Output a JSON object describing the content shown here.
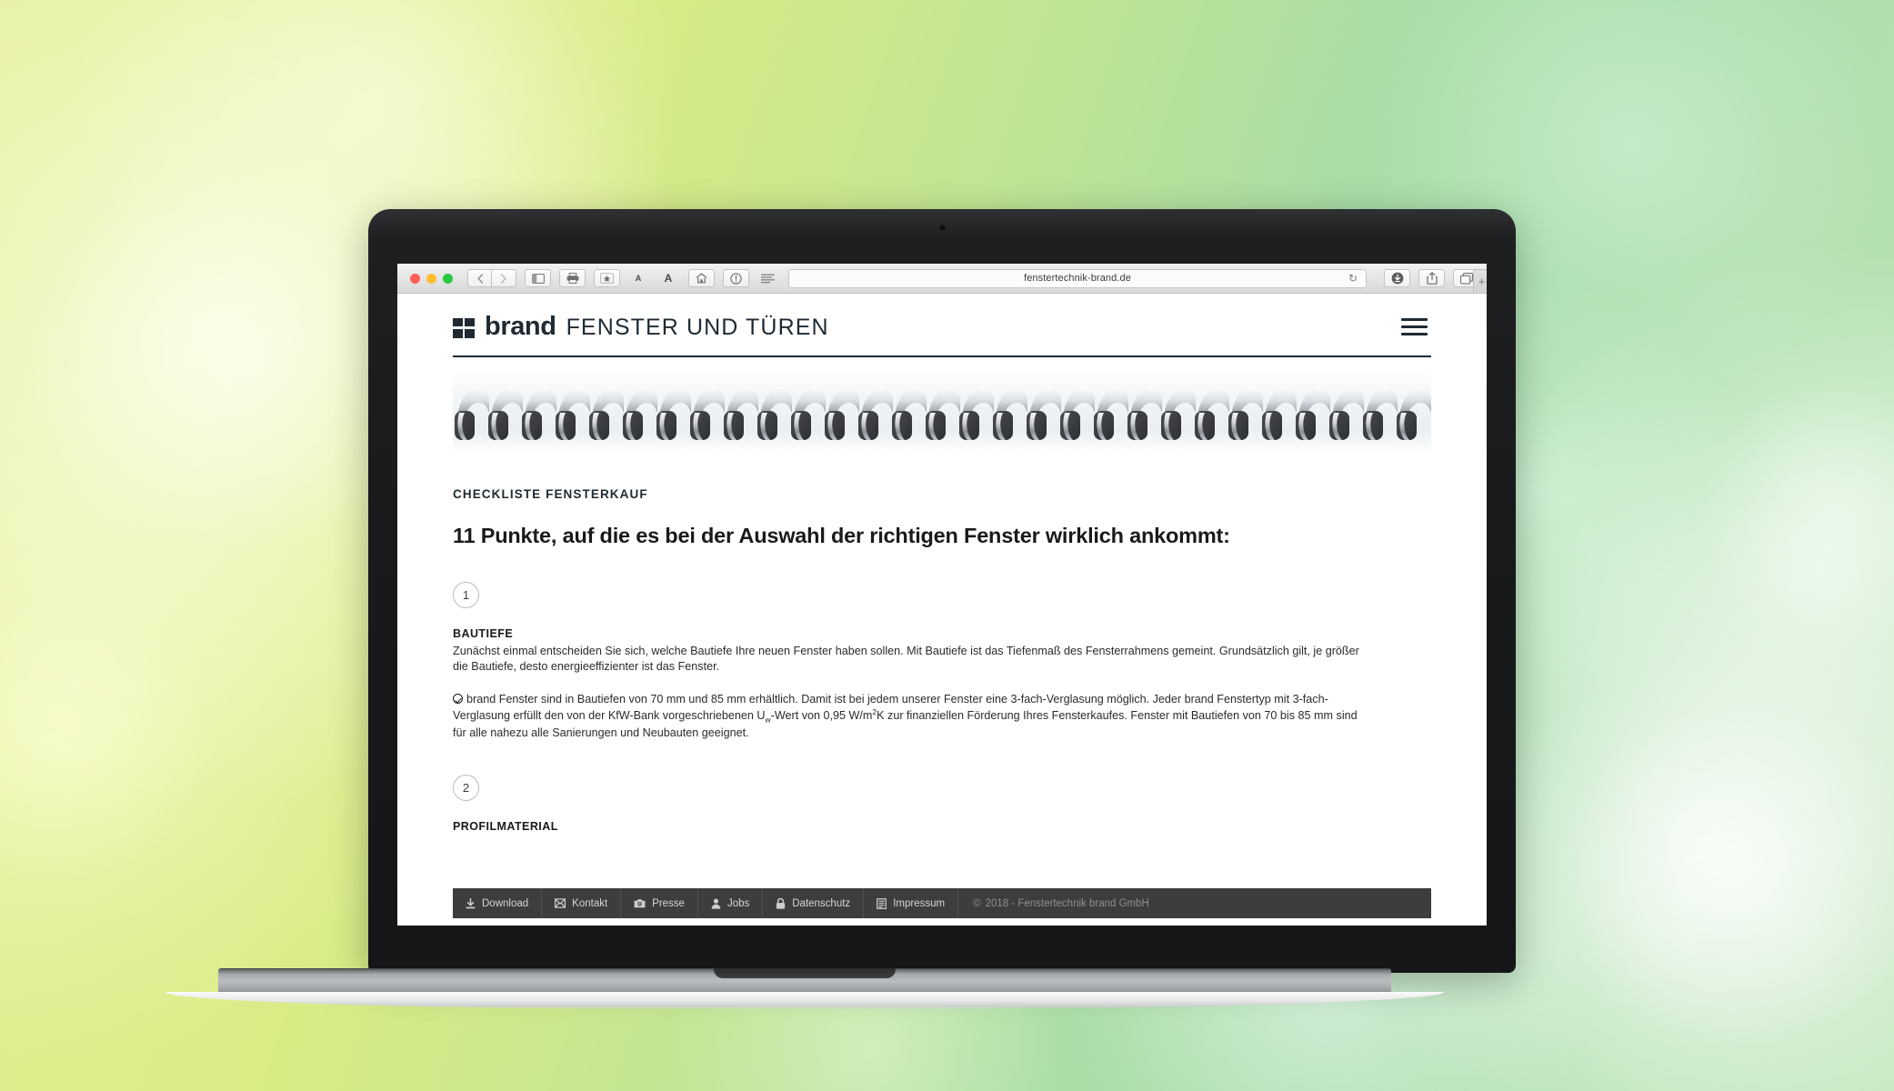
{
  "browser": {
    "url": "fenstertechnik-brand.de",
    "traffic_lights": [
      "close-red",
      "minimize-yellow",
      "maximize-green"
    ],
    "toolbar_icons": [
      "back-arrow-icon",
      "forward-arrow-icon",
      "sidebar-icon",
      "print-icon",
      "bookmark-star-icon",
      "text-smaller-icon",
      "text-larger-icon",
      "home-icon",
      "reader-info-icon",
      "reader-view-icon"
    ],
    "text_size_small": "A",
    "text_size_large": "A",
    "reload_glyph": "↻",
    "new_tab_glyph": "+",
    "right_icons": [
      "downloads-icon",
      "share-icon",
      "tabs-overview-icon"
    ]
  },
  "site": {
    "logo_word": "brand",
    "title": "FENSTER UND TÜREN",
    "menu_icon": "hamburger-menu-icon",
    "banner_image": "spiral-binding-illustration"
  },
  "main": {
    "kicker": "CHECKLISTE FENSTERKAUF",
    "headline": "11 Punkte, auf die es bei der Auswahl der richtigen Fenster wirklich ankommt:",
    "steps": [
      {
        "number": "1",
        "title": "BAUTIEFE",
        "paragraph": "Zunächst einmal entscheiden Sie sich, welche Bautiefe Ihre neuen Fenster haben sollen. Mit Bautiefe ist das Tiefenmaß des Fensterrahmens gemeint. Grundsätzlich gilt, je größer die Bautiefe, desto energieeffizienter ist das Fenster.",
        "highlight_part1": "brand Fenster sind in Bautiefen von 70 mm und 85 mm erhältlich. Damit ist bei jedem unserer Fenster eine 3-fach-Verglasung möglich. Jeder brand Fenstertyp mit 3-fach-Verglasung erfüllt den von der KfW-Bank vorgeschriebenen U",
        "highlight_sub": "w",
        "highlight_part2": "-Wert von 0,95 W/m",
        "highlight_sup": "2",
        "highlight_part3": "K zur finanziellen Förderung Ihres Fensterkaufes. Fenster mit Bautiefen von 70 bis 85 mm sind für alle nahezu alle Sanierungen und Neubauten geeignet.",
        "check_icon": "check-circle-icon"
      },
      {
        "number": "2",
        "title": "PROFILMATERIAL"
      }
    ]
  },
  "footer": {
    "items": [
      {
        "label": "Download",
        "icon": "download-icon"
      },
      {
        "label": "Kontakt",
        "icon": "envelope-icon"
      },
      {
        "label": "Presse",
        "icon": "camera-icon"
      },
      {
        "label": "Jobs",
        "icon": "person-icon"
      },
      {
        "label": "Datenschutz",
        "icon": "lock-icon"
      },
      {
        "label": "Impressum",
        "icon": "document-icon"
      }
    ],
    "copyright": "2018 - Fenstertechnik brand GmbH",
    "copyright_symbol": "©"
  },
  "colors": {
    "brand_dark": "#1f2a33",
    "footer_bg": "#3d3d3d",
    "footer_text": "#d6d6d6",
    "copyright_text": "#8f8f8f",
    "bg_left": "#e4ef9a",
    "bg_right": "#c2e6bd"
  }
}
